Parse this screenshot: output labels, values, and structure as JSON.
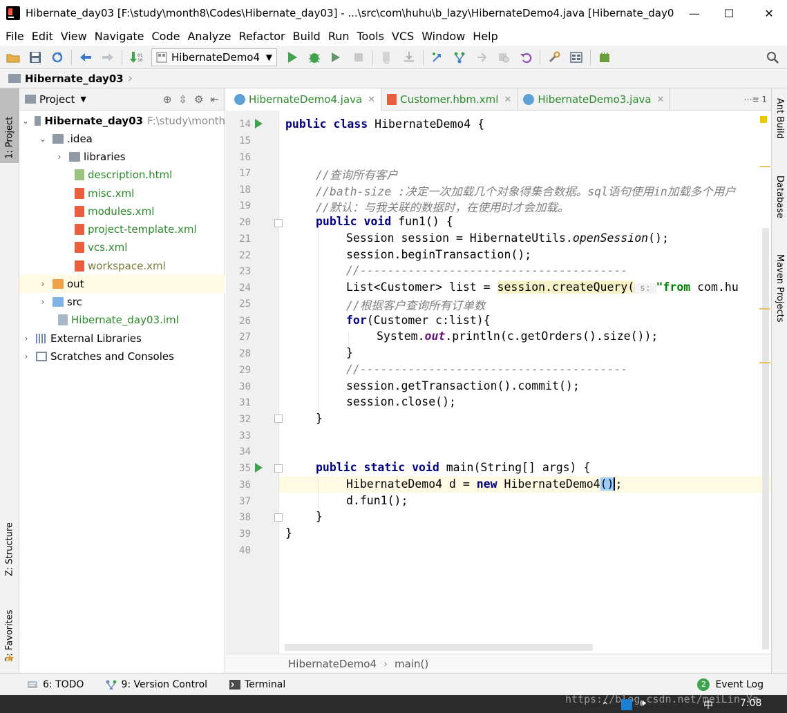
{
  "window": {
    "title": "Hibernate_day03 [F:\\study\\month8\\Codes\\Hibernate_day03] - ...\\src\\com\\huhu\\b_lazy\\HibernateDemo4.java [Hibernate_day0...",
    "minimize": "—",
    "maximize": "☐",
    "close": "✕"
  },
  "menu": [
    "File",
    "Edit",
    "View",
    "Navigate",
    "Code",
    "Analyze",
    "Refactor",
    "Build",
    "Run",
    "Tools",
    "VCS",
    "Window",
    "Help"
  ],
  "toolbar": {
    "run_config": "HibernateDemo4"
  },
  "navbar": {
    "project": "Hibernate_day03"
  },
  "left_strip": {
    "project_tab": "1: Project",
    "structure_tab": "Z: Structure",
    "favorites_tab": "2: Favorites"
  },
  "right_strip": {
    "ant": "Ant Build",
    "database": "Database",
    "maven": "Maven Projects"
  },
  "project_panel": {
    "title": "Project",
    "root_name": "Hibernate_day03",
    "root_path": "F:\\study\\month",
    "idea": ".idea",
    "libraries": "libraries",
    "description": "description.html",
    "misc": "misc.xml",
    "modules": "modules.xml",
    "project_template": "project-template.xml",
    "vcs": "vcs.xml",
    "workspace": "workspace.xml",
    "out": "out",
    "src": "src",
    "iml": "Hibernate_day03.iml",
    "external": "External Libraries",
    "scratches": "Scratches and Consoles"
  },
  "tabs": [
    {
      "label": "HibernateDemo4.java"
    },
    {
      "label": "Customer.hbm.xml"
    },
    {
      "label": "HibernateDemo3.java"
    }
  ],
  "tabs_right": "⋯≡ 1",
  "code": {
    "lines": [
      "14",
      "15",
      "16",
      "17",
      "18",
      "19",
      "20",
      "21",
      "22",
      "23",
      "24",
      "25",
      "26",
      "27",
      "28",
      "29",
      "30",
      "31",
      "32",
      "33",
      "34",
      "35",
      "36",
      "37",
      "38",
      "39",
      "40"
    ],
    "l14a": "public class",
    "l14b": " HibernateDemo4 {",
    "l17": "//查询所有客户",
    "l18": "//bath-size :决定一次加载几个对象得集合数据。sql语句使用in加载多个用户",
    "l19": "//默认：与我关联的数据时，在使用时才会加载。",
    "l20a": "public void",
    "l20b": " fun1() {",
    "l21a": "Session session = HibernateUtils.",
    "l21b": "openSession",
    "l21c": "();",
    "l22": "session.beginTransaction();",
    "l23": "//---------------------------------------",
    "l24a": "List<Customer> list = ",
    "l24b": "session.createQuery(",
    "l24c": " s: ",
    "l24d": "\"from",
    "l24e": " com.hu",
    "l25": "//根据客户查询所有订单数",
    "l26a": "for",
    "l26b": "(Customer c:list){",
    "l27a": "System.",
    "l27b": "out",
    "l27c": ".println(c.getOrders().size());",
    "l28": "}",
    "l29": "//---------------------------------------",
    "l30": "session.getTransaction().commit();",
    "l31": "session.close();",
    "l32": "}",
    "l35a": "public static void",
    "l35b": " main(String[] args) {",
    "l36a": "HibernateDemo4 d = ",
    "l36b": "new",
    "l36c": " HibernateDemo4",
    "l36d": "()",
    "l36e": ";",
    "l37": "d.fun1();",
    "l38": "}",
    "l39": "}"
  },
  "editor_breadcrumb": {
    "class": "HibernateDemo4",
    "sep": "›",
    "method": "main()"
  },
  "status": {
    "todo": "6: TODO",
    "vcs": "9: Version Control",
    "terminal": "Terminal",
    "event_log": "Event Log",
    "event_count": "2"
  },
  "taskbar": {
    "watermark": "https://blog.csdn.net/meiLin Ya",
    "clock": "7:08"
  },
  "colors": {
    "keyword": "#000080",
    "comment": "#808080",
    "string": "#008000",
    "vcs_added": "#2b8a2b"
  }
}
